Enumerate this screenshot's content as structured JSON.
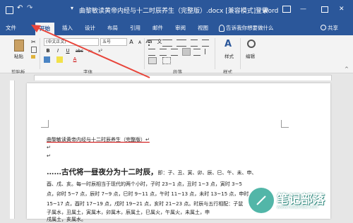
{
  "titlebar": {
    "title": "曲黎敏读黄帝内经与十二时辰养生（完整版）.docx [兼容模式] - Word",
    "login": "登录",
    "minimize": "—",
    "close": "✕"
  },
  "tabs": [
    "文件",
    "开始",
    "插入",
    "设计",
    "布局",
    "引用",
    "邮件",
    "审阅",
    "视图"
  ],
  "active_tab": "开始",
  "tell_me": "告诉我你想要做什么",
  "share": "共享",
  "ribbon": {
    "paste": "粘贴",
    "clipboard": "剪贴板",
    "font_name": "(中文正文)",
    "font_size": "五号",
    "font_group": "字体",
    "paragraph_group": "段落",
    "styles_btn": "样式",
    "styles_group": "样式",
    "edit_btn": "编辑",
    "bold": "B",
    "italic": "I",
    "underline": "U",
    "abc": "abc",
    "sub": "x₂",
    "sup": "x²",
    "font_color": "A",
    "aa": "Aa",
    "wen": "文",
    "a_big": "A",
    "a_small": "A"
  },
  "document": {
    "line1": "曲黎敏读黄帝内经与十二时辰养生（完整版）↵",
    "line2": "↵",
    "line3": "↵",
    "heading": "……古代将一昼夜分为十二时辰，",
    "heading_tail": "即：子、丑、寅、卯、辰、巳、午、未、申、",
    "line5": "酉、戌、亥。每一时辰相当于现代的两个小时，子时 23~1 点，丑时 1~3 点，寅时 3~5",
    "line6": "点，卯时 5~7 点，辰时 7~9 点，巳时 9~11 点，午时 11~13 点，未时 13~15 点，申时",
    "line7": "15~17 点，酉时 17~19 点，戌时 19~21 点，亥时 21~23 点。时辰与五行相配：子鼠",
    "line8": "子属水，丑属土，寅属木，卯属木，辰属土，巳属火，午属火，未属土，申",
    "line9": "戌属土，亥属水。"
  },
  "watermark": {
    "title": "笔记部落",
    "url": "www.notetribe.com"
  },
  "colors": {
    "accent": "#2b579a",
    "arrow": "#e8443a",
    "watermark": "#52b6a8"
  }
}
